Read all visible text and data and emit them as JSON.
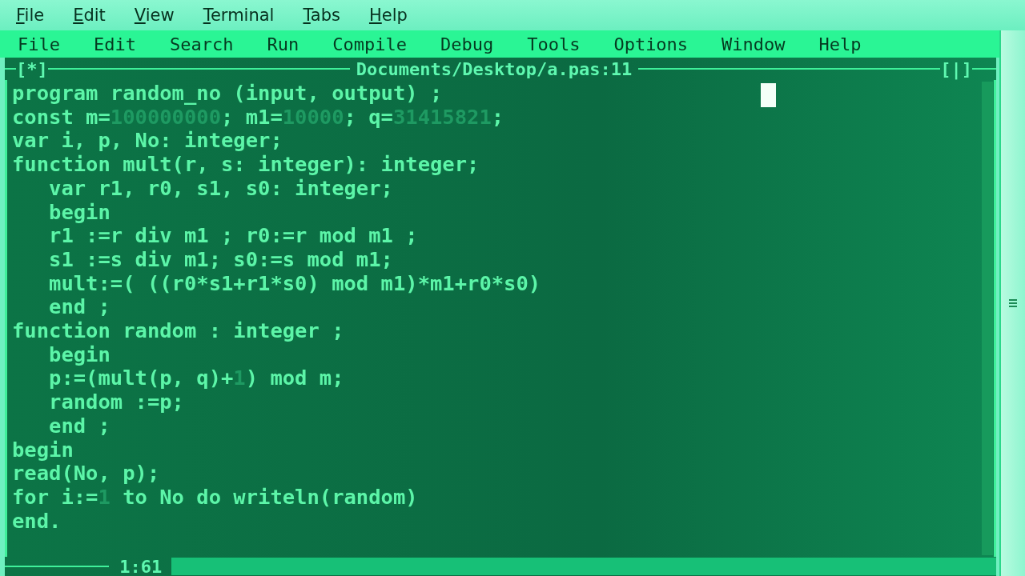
{
  "terminal_menu": [
    "File",
    "Edit",
    "View",
    "Terminal",
    "Tabs",
    "Help"
  ],
  "ide_menu": [
    "File",
    "Edit",
    "Search",
    "Run",
    "Compile",
    "Debug",
    "Tools",
    "Options",
    "Window",
    "Help"
  ],
  "editor": {
    "modified_marker": "[*]",
    "title": "Documents/Desktop/a.pas:11",
    "zoom_marker": "[|]",
    "position": "1:61",
    "lines": [
      [
        {
          "kind": "code",
          "text": "program random_no (input, output) ;"
        }
      ],
      [
        {
          "kind": "code",
          "text": "const m="
        },
        {
          "kind": "number",
          "text": "100000000"
        },
        {
          "kind": "code",
          "text": "; m1="
        },
        {
          "kind": "number",
          "text": "10000"
        },
        {
          "kind": "code",
          "text": "; q="
        },
        {
          "kind": "number",
          "text": "31415821"
        },
        {
          "kind": "code",
          "text": ";"
        }
      ],
      [
        {
          "kind": "code",
          "text": "var i, p, No: integer;"
        }
      ],
      [
        {
          "kind": "code",
          "text": "function mult(r, s: integer): integer;"
        }
      ],
      [
        {
          "kind": "code",
          "text": "   var r1, r0, s1, s0: integer;"
        }
      ],
      [
        {
          "kind": "code",
          "text": "   begin"
        }
      ],
      [
        {
          "kind": "code",
          "text": "   r1 :=r div m1 ; r0:=r mod m1 ;"
        }
      ],
      [
        {
          "kind": "code",
          "text": "   s1 :=s div m1; s0:=s mod m1;"
        }
      ],
      [
        {
          "kind": "code",
          "text": "   mult:=( ((r0*s1+r1*s0) mod m1)*m1+r0*s0)"
        }
      ],
      [
        {
          "kind": "code",
          "text": "   end ;"
        }
      ],
      [
        {
          "kind": "code",
          "text": "function random : integer ;"
        }
      ],
      [
        {
          "kind": "code",
          "text": "   begin"
        }
      ],
      [
        {
          "kind": "code",
          "text": "   p:=(mult(p, q)+"
        },
        {
          "kind": "number",
          "text": "1"
        },
        {
          "kind": "code",
          "text": ") mod m;"
        }
      ],
      [
        {
          "kind": "code",
          "text": "   random :=p;"
        }
      ],
      [
        {
          "kind": "code",
          "text": "   end ;"
        }
      ],
      [
        {
          "kind": "code",
          "text": "begin"
        }
      ],
      [
        {
          "kind": "code",
          "text": "read(No, p);"
        }
      ],
      [
        {
          "kind": "code",
          "text": "for i:="
        },
        {
          "kind": "number",
          "text": "1"
        },
        {
          "kind": "code",
          "text": " to No do writeln(random)"
        }
      ],
      [
        {
          "kind": "code",
          "text": "end."
        }
      ]
    ]
  }
}
